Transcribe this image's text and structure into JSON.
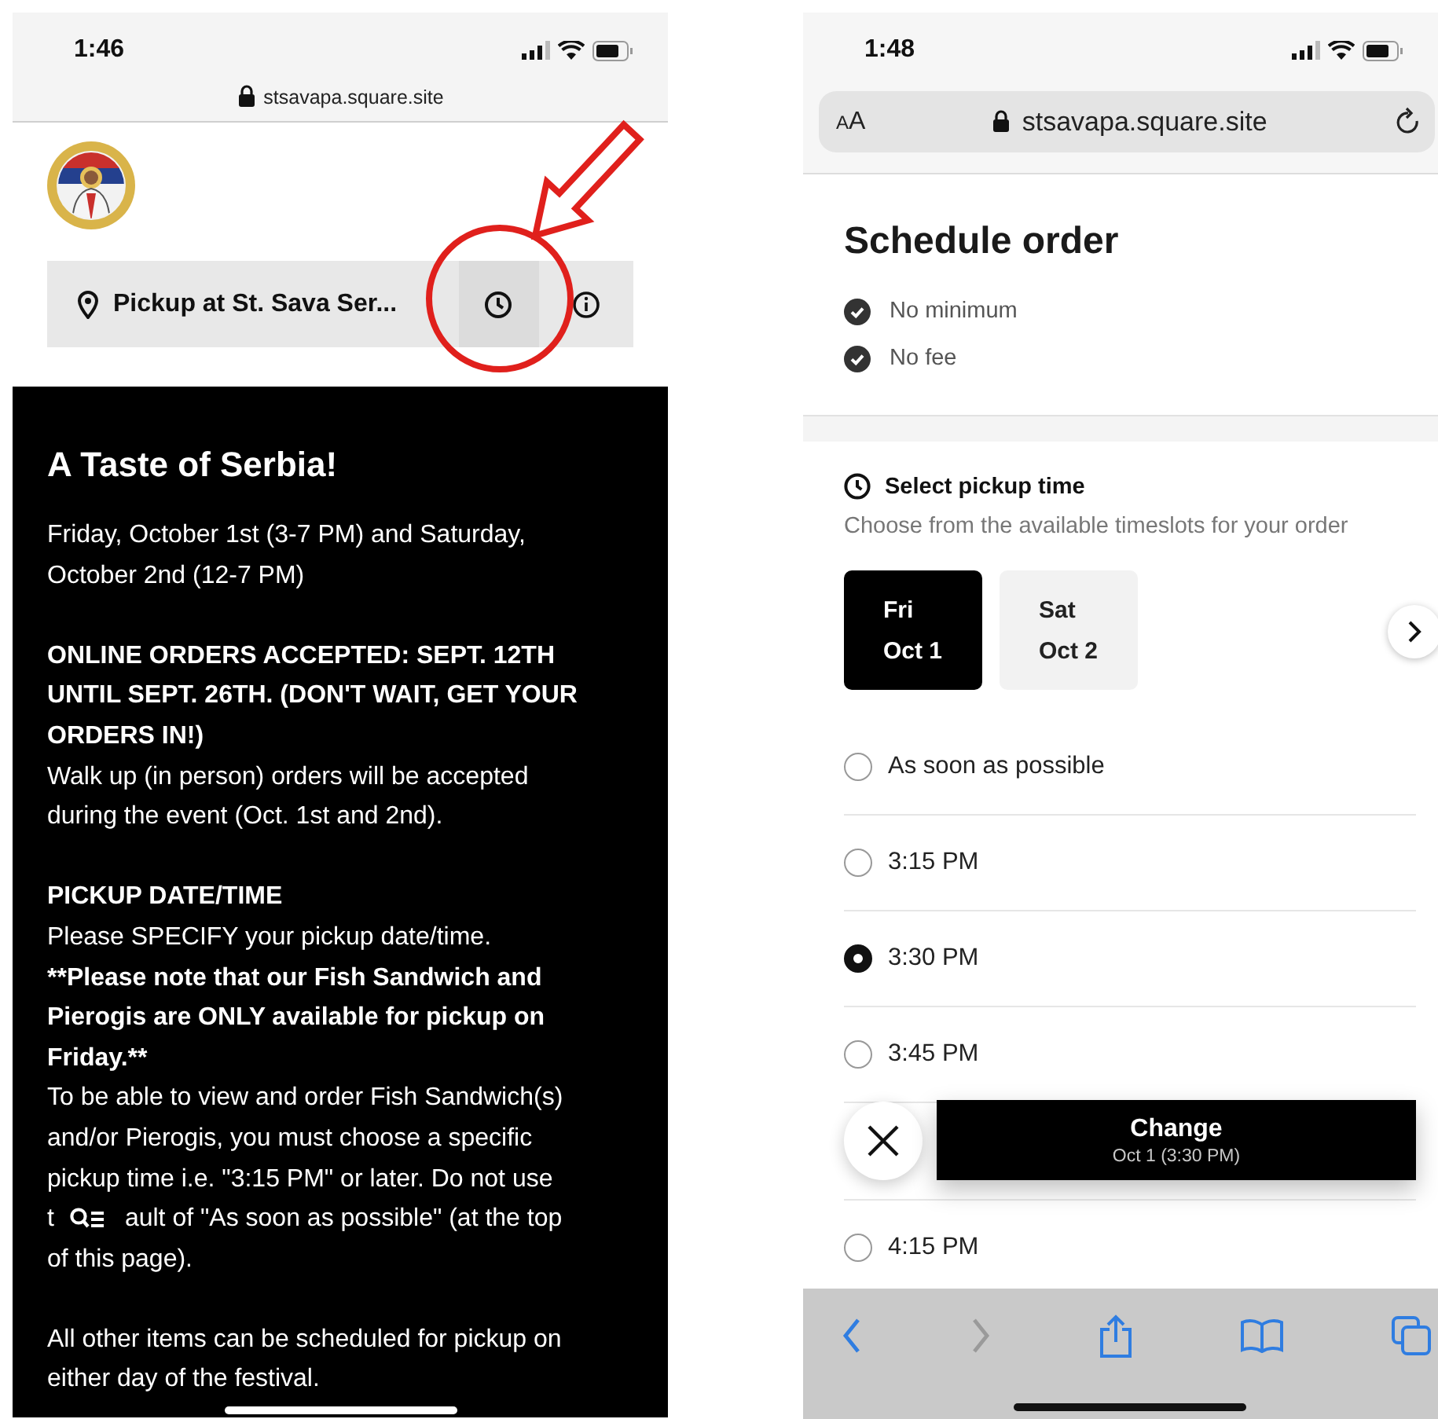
{
  "left_screen": {
    "status_bar": {
      "time": "1:46"
    },
    "address": "stsavapa.square.site",
    "location_bar": {
      "label": "Pickup at St. Sava Ser..."
    },
    "notice": {
      "title": "A Taste of Serbia!",
      "lines": [
        {
          "kind": "text",
          "text": "Friday, October 1st (3-7 PM) and Saturday,"
        },
        {
          "kind": "text",
          "text": "October 2nd (12-7 PM)"
        },
        {
          "kind": "gap"
        },
        {
          "kind": "bold",
          "text": "ONLINE ORDERS ACCEPTED: SEPT. 12TH"
        },
        {
          "kind": "bold",
          "text": "UNTIL SEPT. 26TH. (DON'T WAIT, GET YOUR"
        },
        {
          "kind": "bold",
          "text": "ORDERS IN!)"
        },
        {
          "kind": "text",
          "text": "Walk up (in person) orders will be accepted"
        },
        {
          "kind": "text",
          "text": "during the event (Oct. 1st and 2nd)."
        },
        {
          "kind": "gap"
        },
        {
          "kind": "bold",
          "text": "PICKUP DATE/TIME"
        },
        {
          "kind": "text",
          "text": "Please SPECIFY your pickup date/time."
        },
        {
          "kind": "bold",
          "text": "**Please note that our Fish Sandwich and"
        },
        {
          "kind": "bold",
          "text": "Pierogis are ONLY available for pickup on"
        },
        {
          "kind": "bold",
          "text": "Friday.**"
        },
        {
          "kind": "text",
          "text": "To be able to view and order Fish Sandwich(s)"
        },
        {
          "kind": "text",
          "text": "and/or Pierogis, you must choose a specific"
        },
        {
          "kind": "text",
          "text": "pickup time i.e. \"3:15 PM\" or later. Do not use"
        },
        {
          "kind": "covered",
          "parts": [
            "t",
            "ault of \"As soon as possible\" (at the top"
          ]
        },
        {
          "kind": "text",
          "text": "of this page)."
        },
        {
          "kind": "gap"
        },
        {
          "kind": "text",
          "text": "All other items can be scheduled for pickup on"
        },
        {
          "kind": "text",
          "text": "either day of the festival."
        }
      ]
    }
  },
  "right_screen": {
    "status_bar": {
      "time": "1:48"
    },
    "address_bar": {
      "text_size": "AA",
      "address": "stsavapa.square.site"
    },
    "title": "Schedule order",
    "perks": [
      "No minimum",
      "No fee"
    ],
    "pickup": {
      "heading": "Select pickup time",
      "subtitle": "Choose from the available timeslots for your order",
      "days": [
        {
          "day": "Fri",
          "date": "Oct 1",
          "selected": true
        },
        {
          "day": "Sat",
          "date": "Oct 2",
          "selected": false
        }
      ],
      "slots": [
        {
          "label": "As soon as possible",
          "selected": false
        },
        {
          "label": "3:15 PM",
          "selected": false
        },
        {
          "label": "3:30 PM",
          "selected": true
        },
        {
          "label": "3:45 PM",
          "selected": false
        },
        {
          "label": "4:15 PM",
          "selected": false
        }
      ]
    },
    "change_bar": {
      "label": "Change",
      "detail": "Oct 1 (3:30 PM)"
    }
  }
}
